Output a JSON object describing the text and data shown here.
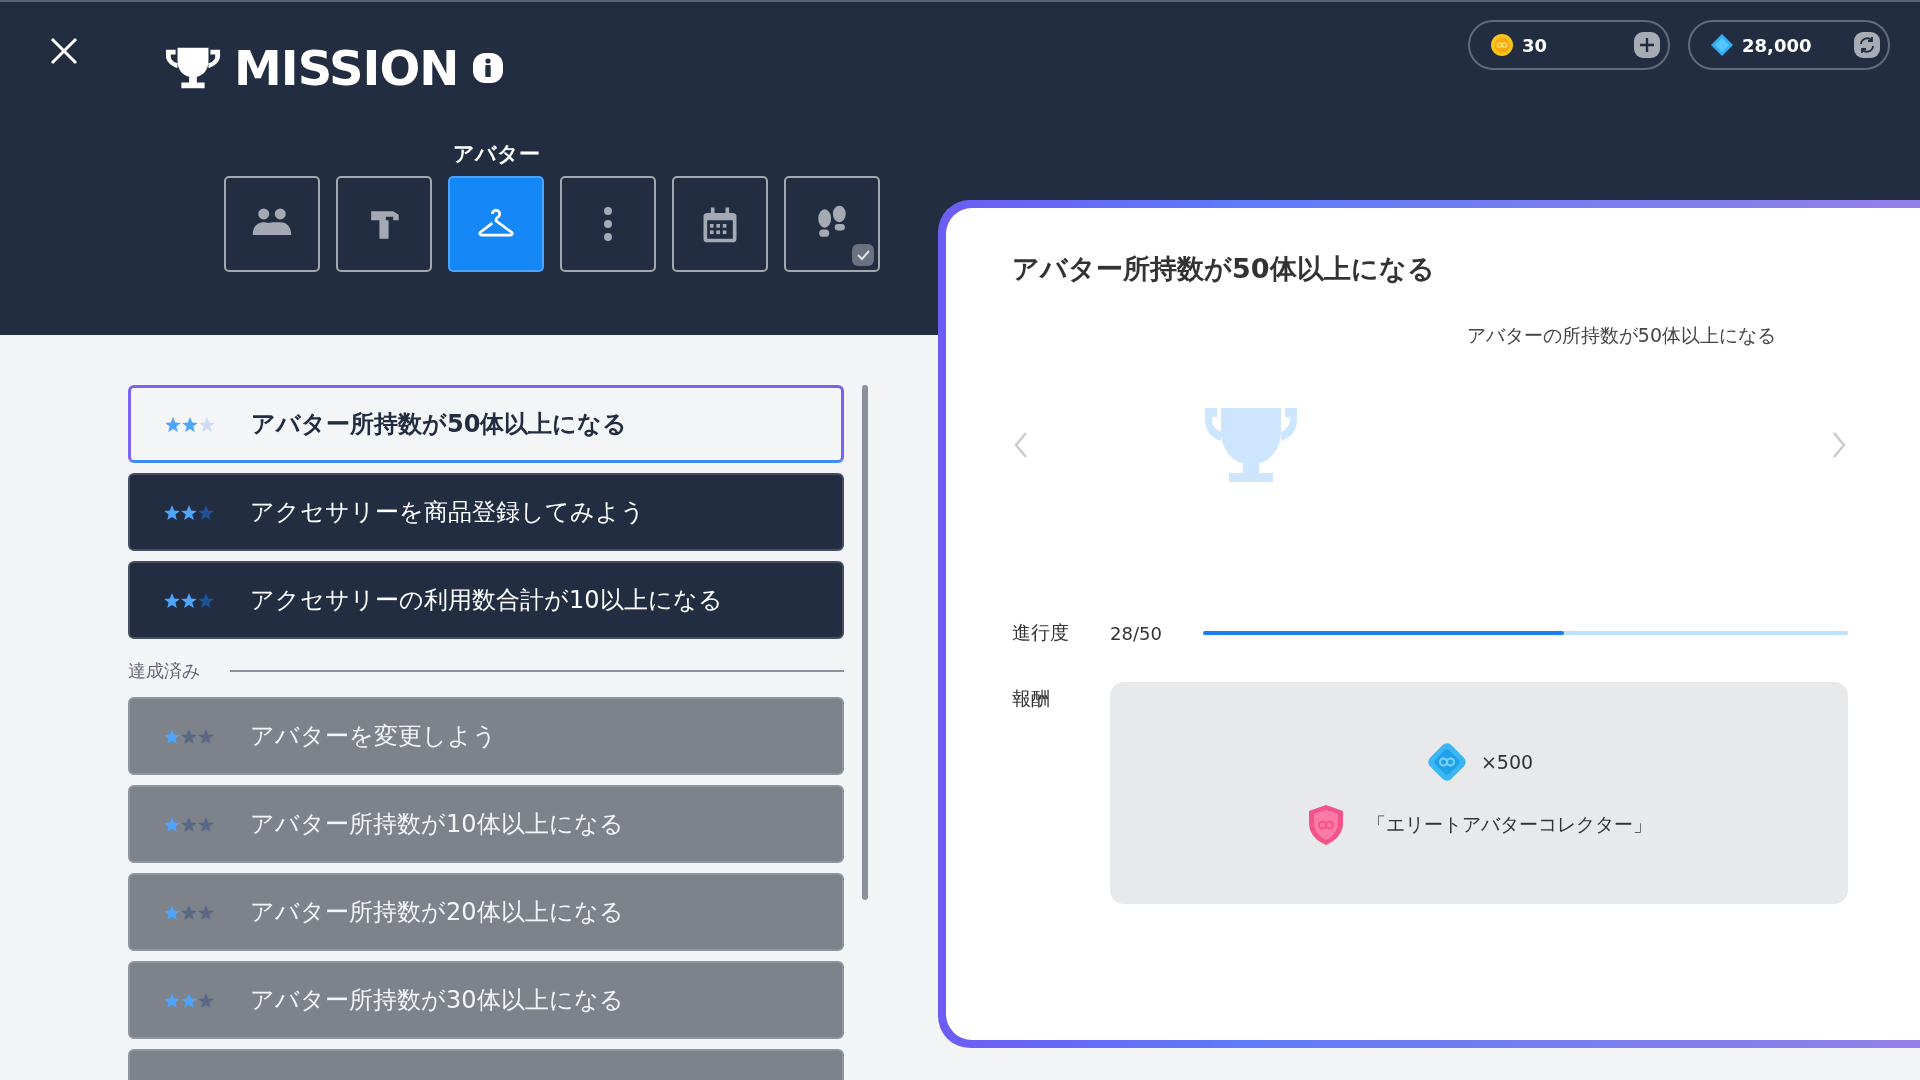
{
  "header": {
    "title": "MISSION"
  },
  "currencies": [
    {
      "kind": "coin",
      "amount": "30"
    },
    {
      "kind": "gem",
      "amount": "28,000"
    }
  ],
  "category_tabs": {
    "label": "アバター",
    "items": [
      {
        "selected": false,
        "checked": false
      },
      {
        "selected": false,
        "checked": false
      },
      {
        "selected": true,
        "checked": false
      },
      {
        "selected": false,
        "checked": false
      },
      {
        "selected": false,
        "checked": false
      },
      {
        "selected": false,
        "checked": true
      }
    ]
  },
  "missions": [
    {
      "text": "アバター所持数が50体以上になる",
      "kind": "open",
      "stars": 2,
      "selected": true
    },
    {
      "text": "アクセサリーを商品登録してみよう",
      "kind": "open",
      "stars": 2,
      "selected": false
    },
    {
      "text": "アクセサリーの利用数合計が10以上になる",
      "kind": "open",
      "stars": 2,
      "selected": false
    }
  ],
  "completed_section": {
    "label": "達成済み",
    "missions": [
      {
        "text": "アバターを変更しよう",
        "kind": "completed",
        "stars": 1,
        "selected": false
      },
      {
        "text": "アバター所持数が10体以上になる",
        "kind": "completed",
        "stars": 1,
        "selected": false
      },
      {
        "text": "アバター所持数が20体以上になる",
        "kind": "completed",
        "stars": 1,
        "selected": false
      },
      {
        "text": "アバター所持数が30体以上になる",
        "kind": "completed",
        "stars": 2,
        "selected": false
      },
      {
        "kind": "completed",
        "selected": false
      }
    ]
  },
  "detail": {
    "title": "アバター所持数が50体以上になる",
    "description": "アバターの所持数が50体以上になる",
    "progress": {
      "label": "進行度",
      "reading": "28/50",
      "level": 0.56
    },
    "reward": {
      "label": "報酬",
      "items": [
        {
          "kind": "gem",
          "text": "×500"
        },
        {
          "kind": "badge",
          "text": "「エリートアバターコレクター」"
        }
      ]
    }
  }
}
